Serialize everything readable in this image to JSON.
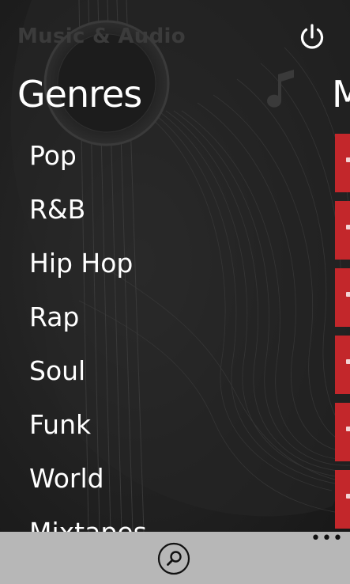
{
  "header": {
    "app_title": "Music & Audio",
    "power_icon": "power-icon",
    "background_icon": "music-note-icon"
  },
  "pivot": {
    "current_title": "Genres",
    "next_title_peek": "M"
  },
  "genres": [
    {
      "label": "Pop"
    },
    {
      "label": "R&B"
    },
    {
      "label": "Hip Hop"
    },
    {
      "label": "Rap"
    },
    {
      "label": "Soul"
    },
    {
      "label": "Funk"
    },
    {
      "label": "World"
    },
    {
      "label": "Mixtapes"
    }
  ],
  "tiles": {
    "color": "#c3272b",
    "count": 6
  },
  "app_bar": {
    "background": "#b7b7b7",
    "search_icon": "search-icon",
    "more_label": "•••"
  }
}
